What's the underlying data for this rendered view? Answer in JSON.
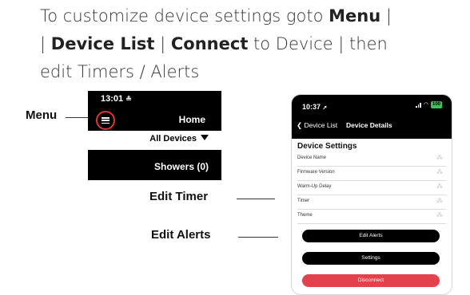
{
  "intro": {
    "line1_a": "To customize device settings goto ",
    "line1_b": "Menu",
    "line1_c": " |",
    "line2_a": "| ",
    "line2_b": "Device List",
    "line2_c": " | ",
    "line2_d": "Connect",
    "line2_e": " to Device | then",
    "line3": "edit Timers / Alerts"
  },
  "callouts": {
    "menu": "Menu",
    "edit_timer": "Edit Timer",
    "edit_alerts": "Edit Alerts"
  },
  "phone_home": {
    "time": "13:01",
    "person_glyph": "≗",
    "title": "Home",
    "filter": "All Devices",
    "showers": "Showers (0)"
  },
  "phone_details": {
    "time": "10:37",
    "location_glyph": "➚",
    "battery": "100",
    "back_label": "Device List",
    "title": "Device Details",
    "section_title": "Device Settings",
    "settings": [
      "Device Name",
      "Firmware Version",
      "Warm-Up Delay",
      "Timer",
      "Theme"
    ],
    "loading_glyph": "⁂",
    "buttons": {
      "edit_alerts": "Edit Alerts",
      "settings": "Settings",
      "disconnect": "Disconnect"
    },
    "colors": {
      "dark_button": "#000000",
      "disconnect_button": "#e3414b"
    }
  },
  "colors": {
    "menu_highlight": "#e0352b"
  }
}
